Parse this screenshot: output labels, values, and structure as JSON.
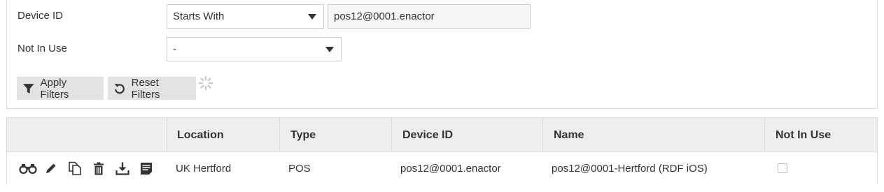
{
  "filters": {
    "device_id_label": "Device ID",
    "device_id_operator": "Starts With",
    "device_id_value": "pos12@0001.enactor",
    "not_in_use_label": "Not In Use",
    "not_in_use_value": "-",
    "apply_label": "Apply Filters",
    "reset_label": "Reset Filters"
  },
  "table": {
    "headers": [
      "",
      "Location",
      "Type",
      "Device ID",
      "Name",
      "Not In Use"
    ],
    "rows": [
      {
        "location": "UK Hertford",
        "type": "POS",
        "device_id": "pos12@0001.enactor",
        "name": "pos12@0001-Hertford (RDF iOS)",
        "not_in_use": false,
        "actions": [
          "view-icon",
          "edit-icon",
          "copy-icon",
          "delete-icon",
          "download-icon",
          "notes-icon"
        ]
      }
    ]
  }
}
